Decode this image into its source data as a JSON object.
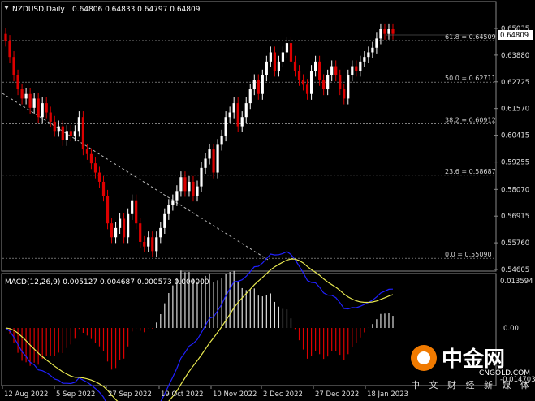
{
  "header": {
    "symbol": "NZDUSD,Daily",
    "ohlc": "0.64806 0.64833 0.64797 0.64809"
  },
  "price_axis": {
    "labels": [
      "0.65035",
      "0.63880",
      "0.62725",
      "0.61570",
      "0.60415",
      "0.59255",
      "0.58070",
      "0.56915",
      "0.55760",
      "0.54605"
    ],
    "current_price": "0.64809"
  },
  "macd": {
    "title": "MACD(12,26,9) 0.005127 0.004687 0.000573 0.000000",
    "axis_labels": [
      "0.013594",
      "0.00",
      "-0.014703"
    ]
  },
  "fibonacci": [
    {
      "label": "61.8 = 0.64509",
      "value": 0.64509
    },
    {
      "label": "50.0 = 0.62711",
      "value": 0.62711
    },
    {
      "label": "38.2 = 0.60912",
      "value": 0.60912
    },
    {
      "label": "23.6 = 0.58687",
      "value": 0.58687
    },
    {
      "label": "0.0 = 0.55090",
      "value": 0.5509
    }
  ],
  "time_axis": [
    "12 Aug 2022",
    "5 Sep 2022",
    "27 Sep 2022",
    "19 Oct 2022",
    "10 Nov 2022",
    "2 Dec 2022",
    "27 Dec 2022",
    "18 Jan 2023"
  ],
  "watermark": {
    "brand": "中金网",
    "site": "CNGOLD.COM",
    "slogan": "中 文 财 经 新 媒 体"
  },
  "colors": {
    "bull": "#ffffff",
    "bear": "#dd0000",
    "signal": "#e8e850",
    "macd_line": "#2020ff",
    "grid": "#b0b0b0"
  },
  "chart_data": {
    "type": "candlestick",
    "price_range": [
      0.54605,
      0.65035
    ],
    "series_close": [
      0.645,
      0.638,
      0.63,
      0.624,
      0.62,
      0.622,
      0.616,
      0.62,
      0.612,
      0.618,
      0.614,
      0.61,
      0.606,
      0.608,
      0.602,
      0.606,
      0.604,
      0.606,
      0.612,
      0.598,
      0.596,
      0.592,
      0.588,
      0.584,
      0.578,
      0.566,
      0.56,
      0.564,
      0.568,
      0.56,
      0.57,
      0.576,
      0.566,
      0.558,
      0.556,
      0.56,
      0.554,
      0.56,
      0.564,
      0.57,
      0.574,
      0.576,
      0.58,
      0.586,
      0.58,
      0.584,
      0.578,
      0.582,
      0.59,
      0.594,
      0.598,
      0.588,
      0.6,
      0.604,
      0.612,
      0.614,
      0.618,
      0.608,
      0.612,
      0.618,
      0.624,
      0.628,
      0.622,
      0.63,
      0.636,
      0.64,
      0.632,
      0.636,
      0.64,
      0.644,
      0.636,
      0.632,
      0.628,
      0.626,
      0.622,
      0.632,
      0.636,
      0.628,
      0.624,
      0.63,
      0.634,
      0.63,
      0.624,
      0.62,
      0.63,
      0.634,
      0.632,
      0.636,
      0.638,
      0.64,
      0.642,
      0.646,
      0.65,
      0.648,
      0.65,
      0.648
    ]
  }
}
